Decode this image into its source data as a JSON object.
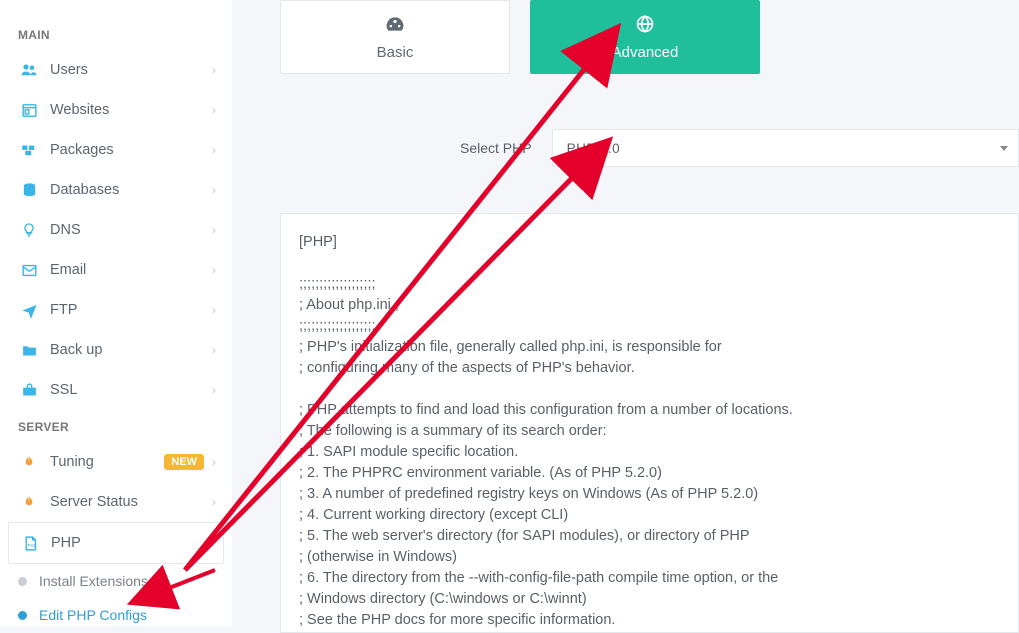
{
  "sidebar": {
    "sections": {
      "main_heading": "MAIN",
      "server_heading": "SERVER"
    },
    "main_items": [
      {
        "label": "Users",
        "icon": "users"
      },
      {
        "label": "Websites",
        "icon": "website"
      },
      {
        "label": "Packages",
        "icon": "packages"
      },
      {
        "label": "Databases",
        "icon": "db"
      },
      {
        "label": "DNS",
        "icon": "dns"
      },
      {
        "label": "Email",
        "icon": "email"
      },
      {
        "label": "FTP",
        "icon": "ftp"
      },
      {
        "label": "Back up",
        "icon": "backup"
      },
      {
        "label": "SSL",
        "icon": "ssl"
      }
    ],
    "server_items": [
      {
        "label": "Tuning",
        "icon": "flame",
        "badge": "NEW"
      },
      {
        "label": "Server Status",
        "icon": "flame"
      },
      {
        "label": "PHP",
        "icon": "phpfile",
        "active": true
      }
    ],
    "sub_items": [
      {
        "label": "Install Extensions",
        "active": false
      },
      {
        "label": "Edit PHP Configs",
        "active": true
      }
    ]
  },
  "tabs": {
    "basic": {
      "label": "Basic",
      "icon": "gauge"
    },
    "advanced": {
      "label": "Advanced",
      "icon": "globe"
    }
  },
  "select": {
    "label": "Select PHP",
    "value": "PHP 7.0"
  },
  "config_text": "[PHP]\n\n;;;;;;;;;;;;;;;;;;;\n; About php.ini   ;\n;;;;;;;;;;;;;;;;;;;\n; PHP's initialization file, generally called php.ini, is responsible for\n; configuring many of the aspects of PHP's behavior.\n\n; PHP attempts to find and load this configuration from a number of locations.\n; The following is a summary of its search order:\n; 1. SAPI module specific location.\n; 2. The PHPRC environment variable. (As of PHP 5.2.0)\n; 3. A number of predefined registry keys on Windows (As of PHP 5.2.0)\n; 4. Current working directory (except CLI)\n; 5. The web server's directory (for SAPI modules), or directory of PHP\n; (otherwise in Windows)\n; 6. The directory from the --with-config-file-path compile time option, or the\n; Windows directory (C:\\windows or C:\\winnt)\n; See the PHP docs for more specific information.\n; http://php.net/configuration.file"
}
